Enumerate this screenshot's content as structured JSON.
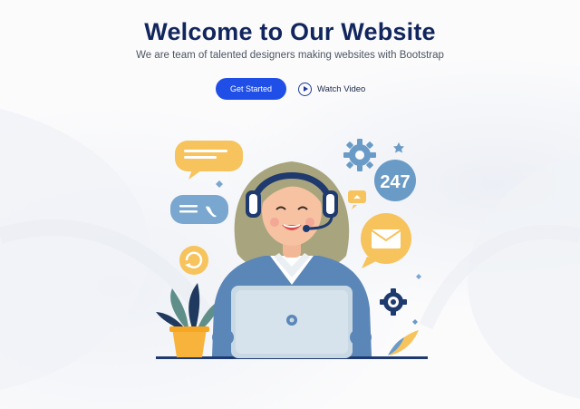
{
  "hero": {
    "title": "Welcome to Our Website",
    "subtitle": "We are team of talented designers making websites with Bootstrap",
    "primary_button": "Get Started",
    "secondary_button": "Watch Video"
  },
  "illustration": {
    "badge_text": "247",
    "colors": {
      "navy": "#12265e",
      "accent_blue": "#1f4fe6",
      "bubble_yellow": "#f7c35c",
      "bubble_blue": "#6a9bc7",
      "jacket": "#5b86b8",
      "laptop": "#c9d9e4"
    }
  }
}
